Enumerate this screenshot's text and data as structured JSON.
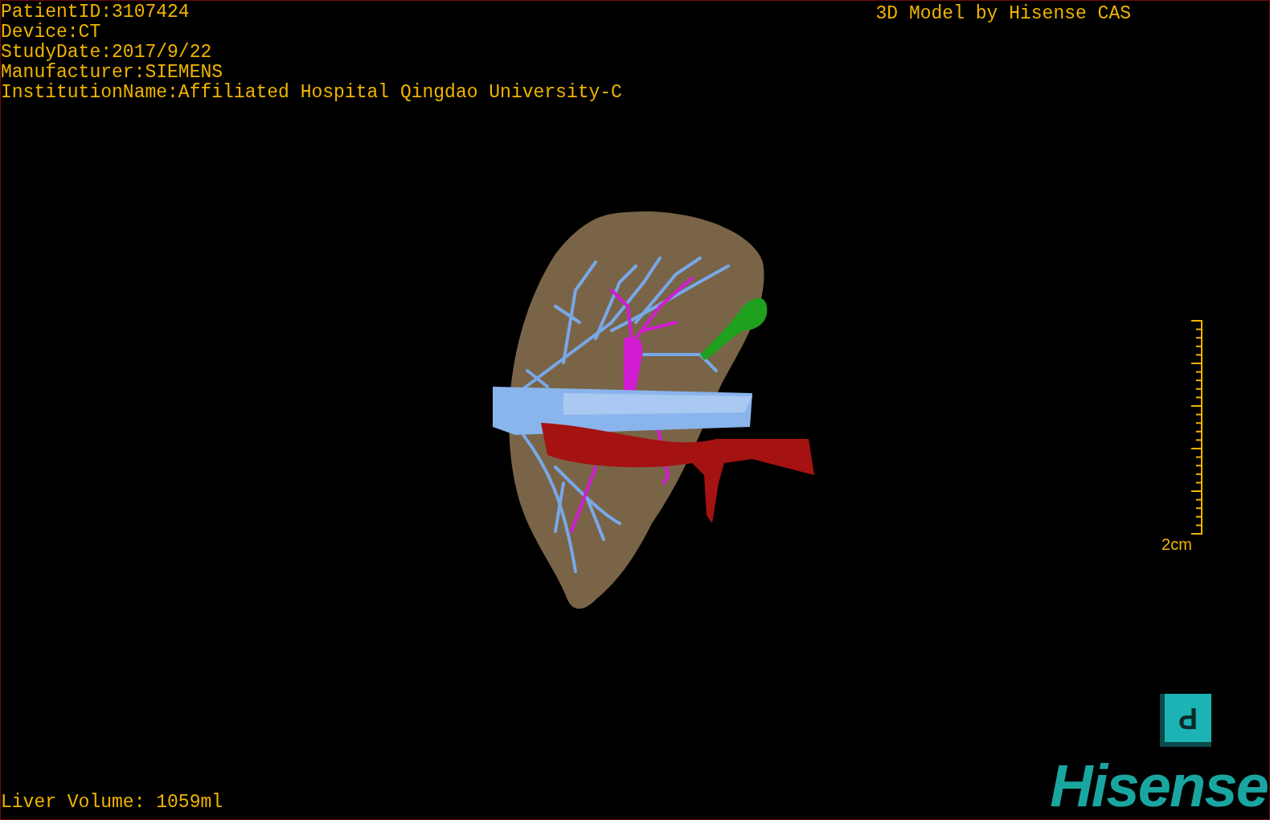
{
  "patient_info": [
    "PatientID:3107424",
    "Device:CT",
    "StudyDate:2017/9/22",
    "Manufacturer:SIEMENS",
    "InstitutionName:Affiliated Hospital Qingdao University-C"
  ],
  "title": "3D Model by Hisense CAS",
  "scale_bar": {
    "label": "2cm"
  },
  "orientation_cube": {
    "label": "P"
  },
  "liver_volume": "Liver Volume: 1059ml",
  "logo": "Hisense"
}
